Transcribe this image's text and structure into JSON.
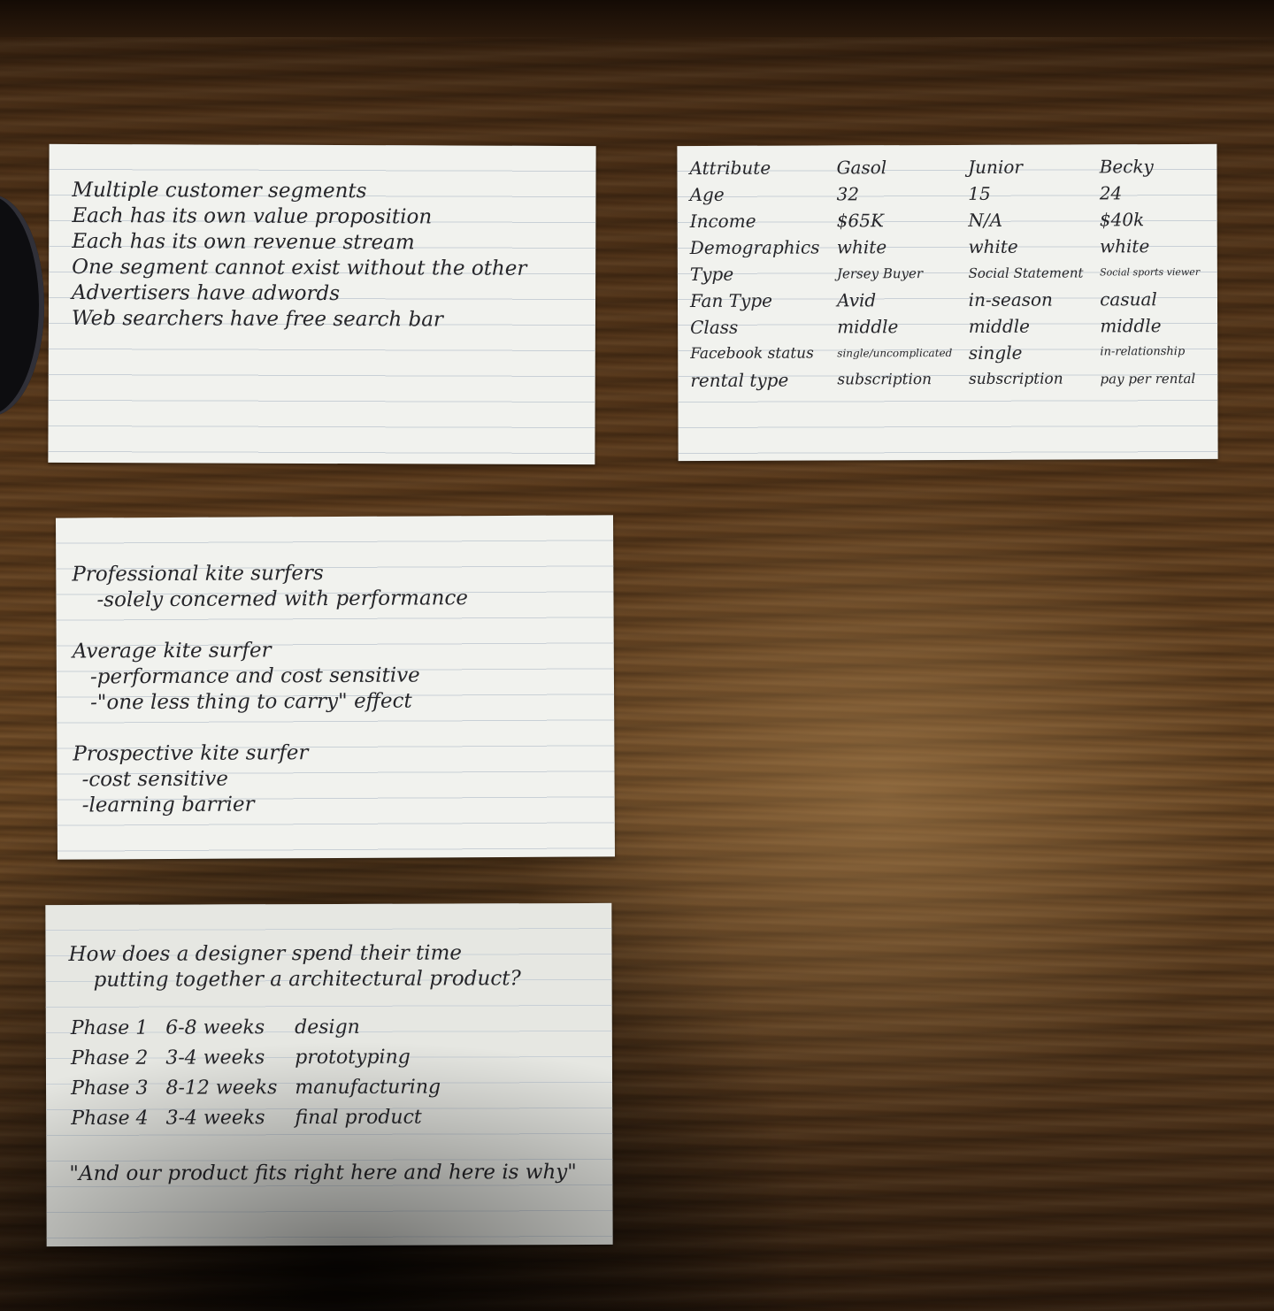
{
  "card1": {
    "lines": [
      "Multiple customer segments",
      "Each has its own value proposition",
      "Each has its own revenue stream",
      "One segment cannot exist without the other",
      "Advertisers have adwords",
      "Web searchers have free search bar"
    ]
  },
  "card2": {
    "header": [
      "Attribute",
      "Gasol",
      "Junior",
      "Becky"
    ],
    "rows": [
      [
        "Age",
        "32",
        "15",
        "24"
      ],
      [
        "Income",
        "$65K",
        "N/A",
        "$40k"
      ],
      [
        "Demographics",
        "white",
        "white",
        "white"
      ],
      [
        "Type",
        "Jersey Buyer",
        "Social Statement",
        "Social sports viewer"
      ],
      [
        "Fan Type",
        "Avid",
        "in-season",
        "casual"
      ],
      [
        "Class",
        "middle",
        "middle",
        "middle"
      ],
      [
        "Facebook status",
        "single/uncomplicated",
        "single",
        "in-relationship"
      ],
      [
        "rental type",
        "subscription",
        "subscription",
        "pay per rental"
      ]
    ]
  },
  "card3": {
    "groups": [
      {
        "title": "Professional kite surfers",
        "items": [
          "-solely concerned with performance"
        ]
      },
      {
        "title": "Average kite surfer",
        "items": [
          "-performance and cost sensitive",
          "-\"one less thing to carry\" effect"
        ]
      },
      {
        "title": "Prospective kite surfer",
        "items": [
          "-cost sensitive",
          "-learning barrier"
        ]
      }
    ]
  },
  "card4": {
    "question_line1": "How does a designer spend their time",
    "question_line2": "putting together a architectural product?",
    "phases": [
      [
        "Phase 1",
        "6-8 weeks",
        "design"
      ],
      [
        "Phase 2",
        "3-4 weeks",
        "prototyping"
      ],
      [
        "Phase 3",
        "8-12 weeks",
        "manufacturing"
      ],
      [
        "Phase 4",
        "3-4 weeks",
        "final product"
      ]
    ],
    "quote": "\"And our product fits right here and here is why\""
  }
}
